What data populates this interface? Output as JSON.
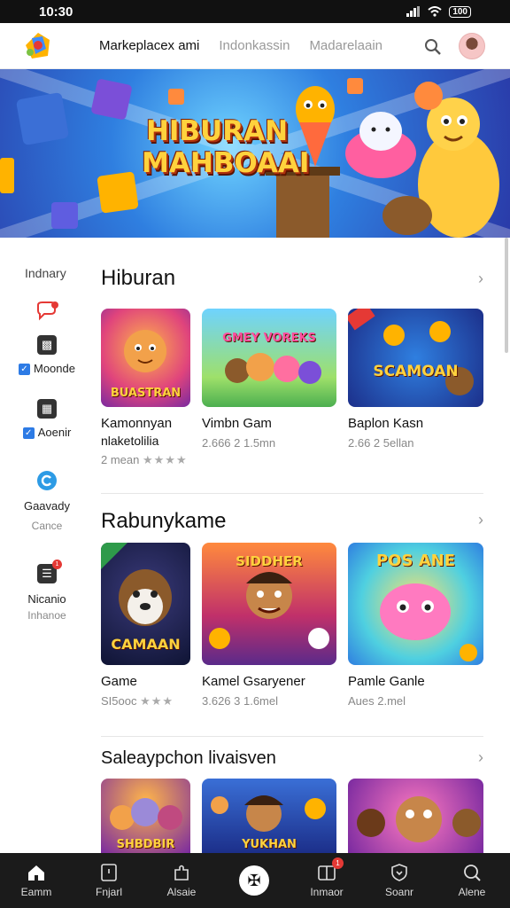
{
  "status": {
    "time": "10:30",
    "battery": "100"
  },
  "nav": {
    "tabs": [
      "Markeplacex ami",
      "Indonkassin",
      "Madarelaain"
    ]
  },
  "hero": {
    "title": "HIBURAN MAHBOAAI"
  },
  "sidebar": {
    "heading": "Indnary",
    "items": [
      {
        "label": "Moonde",
        "checked": true
      },
      {
        "label": "Aoenir",
        "checked": true
      },
      {
        "label": "Gaavady",
        "sub": "Cance"
      },
      {
        "label": "Nicanio",
        "sub": "Inhanoe"
      }
    ]
  },
  "sections": [
    {
      "title": "Hiburan",
      "cards": [
        {
          "label": "BUASTRAN",
          "title": "Kamonnyan",
          "subtitle": "nlaketolilia",
          "meta": "2 mean"
        },
        {
          "label": "GMEY VOREKS",
          "title": "Vimbn Gam",
          "subtitle": "",
          "meta": "2.666 2 1.5mn"
        },
        {
          "label": "SCAMOAN",
          "title": "Baplon Kasn",
          "subtitle": "",
          "meta": "2.66 2 5ellan"
        }
      ]
    },
    {
      "title": "Rabunykame",
      "cards": [
        {
          "label": "CAMAAN",
          "title": "Game",
          "subtitle": "",
          "meta": "SI5ooc"
        },
        {
          "label": "SIDDHER",
          "title": "Kamel Gsaryener",
          "subtitle": "",
          "meta": "3.626 3 1.6mel"
        },
        {
          "label": "POS ANE",
          "title": "Pamle Ganle",
          "subtitle": "",
          "meta": "Aues 2.mel"
        }
      ]
    },
    {
      "title": "Saleaypchon livaisven",
      "cards": [
        {
          "label": "SHBDBIR",
          "title": "",
          "subtitle": "",
          "meta": ""
        },
        {
          "label": "YUKHAN",
          "title": "",
          "subtitle": "",
          "meta": ""
        },
        {
          "label": "",
          "title": "",
          "subtitle": "",
          "meta": ""
        }
      ]
    }
  ],
  "bottom_nav": [
    "Eamm",
    "Fnjarl",
    "Alsaie",
    "",
    "Inmaor",
    "Soanr",
    "Alene"
  ],
  "bottom_badge": "1",
  "sidebar_badge": "1",
  "colors": {
    "accent": "#2d7be5",
    "badge": "#e53935",
    "dark": "#1b1b1b"
  }
}
